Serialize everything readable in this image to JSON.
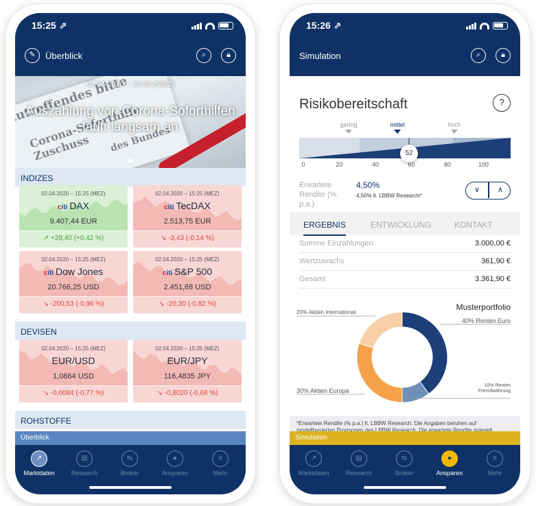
{
  "phone1": {
    "status": {
      "time": "15:25 ⇗"
    },
    "appbar": {
      "title": "Überblick"
    },
    "hero": {
      "meta": "02.04.2020 – 14:29 (MEZ)",
      "headline": "Auszahlung von Corona-Soforthilfen läuft langsam an",
      "paper_lines": [
        "Zutreffendes bitte",
        "Corona-Soforthilfe Zuschuss",
        "des Bundes"
      ]
    },
    "sections": [
      {
        "title": "INDIZES"
      },
      {
        "title": "DEVISEN"
      },
      {
        "title": "ROHSTOFFE"
      }
    ],
    "tiles": [
      {
        "date": "02.04.2020 – 15:25 (MEZ)",
        "brand": "citi",
        "name": "DAX",
        "value": "9.407,44 EUR",
        "change": "↗ +39,40 (+0,42 %)",
        "trend": "up"
      },
      {
        "date": "02.04.2020 – 15:25 (MEZ)",
        "brand": "citi",
        "name": "TecDAX",
        "value": "2.513,75 EUR",
        "change": "↘ -3,43 (-0,14 %)",
        "trend": "down"
      },
      {
        "date": "02.04.2020 – 15:25 (MEZ)",
        "brand": "citi",
        "name": "Dow Jones",
        "value": "20.766,25 USD",
        "change": "↘ -200,53 (-0,96 %)",
        "trend": "down"
      },
      {
        "date": "02.04.2020 – 15:25 (MEZ)",
        "brand": "citi",
        "name": "S&P 500",
        "value": "2.451,68 USD",
        "change": "↘ -20,30 (-0,82 %)",
        "trend": "down"
      },
      {
        "date": "02.04.2020 – 15:25 (MEZ)",
        "brand": "",
        "name": "EUR/USD",
        "value": "1,0864 USD",
        "change": "↘ -0,0084 (-0,77 %)",
        "trend": "down"
      },
      {
        "date": "02.04.2020 – 15:25 (MEZ)",
        "brand": "",
        "name": "EUR/JPY",
        "value": "116,4835 JPY",
        "change": "↘ -0,8020 (-0,68 %)",
        "trend": "down"
      }
    ],
    "mini_bar": "Überblick",
    "tabs": [
      {
        "label": "Marktdaten",
        "icon": "chart-icon"
      },
      {
        "label": "Research",
        "icon": "document-icon"
      },
      {
        "label": "Broker",
        "icon": "transfer-icon"
      },
      {
        "label": "Ansparen",
        "icon": "piggy-icon"
      },
      {
        "label": "Mehr",
        "icon": "more-icon"
      }
    ],
    "active_tab": 0,
    "colors": {
      "brand": "#0f3266",
      "up": "#4aa33a",
      "down": "#d9453d"
    }
  },
  "phone2": {
    "status": {
      "time": "15:26 ⇗"
    },
    "appbar": {
      "title": "Simulation"
    },
    "risk": {
      "title": "Risikobereitschaft",
      "help": "?",
      "levels": [
        "gering",
        "mittel",
        "hoch"
      ],
      "selected_level": "mittel",
      "scale_ticks": [
        "0",
        "20",
        "40",
        "60",
        "80",
        "100"
      ],
      "value": "52"
    },
    "return": {
      "label": "Erwartete Rendite (% p.a.)",
      "value": "4,50%",
      "sub": "4,50% lt. LBBW Research*"
    },
    "tabs2": [
      "ERGEBNIS",
      "ENTWICKLUNG",
      "KONTAKT"
    ],
    "results": [
      {
        "label": "Summe Einzahlungen",
        "value": "3.000,00 €"
      },
      {
        "label": "Wertzuwachs",
        "value": "361,90 €"
      },
      {
        "label": "Gesamt",
        "value": "3.361,90 €"
      }
    ],
    "portfolio_title": "Musterportfolio",
    "chart_data": {
      "type": "pie",
      "title": "Musterportfolio",
      "series": [
        {
          "name": "Renten Euro",
          "value": 40,
          "label": "40% Renten Euro",
          "color": "#1c3f78"
        },
        {
          "name": "Renten Fremdwährung",
          "value": 10,
          "label": "10% Renten Fremdwährung",
          "color": "#6f8fb8"
        },
        {
          "name": "Aktien Europa",
          "value": 30,
          "label": "30% Aktien Europa",
          "color": "#f5a14a"
        },
        {
          "name": "Aktien International",
          "value": 20,
          "label": "20% Aktien International",
          "color": "#f8cfa6"
        }
      ]
    },
    "disclaimer": "*Erwartete Rendite (% p.a.) lt. LBBW Research: Die Angaben beruhen auf modellbasierten Prognosen des LBBW Research. Die erwartete Rendite spiegelt Durchschnittswerte der jeweiligen Anlageklasse in",
    "mini_bar": "Simulation",
    "tabs": [
      {
        "label": "Marktdaten",
        "icon": "chart-icon"
      },
      {
        "label": "Research",
        "icon": "document-icon"
      },
      {
        "label": "Broker",
        "icon": "transfer-icon"
      },
      {
        "label": "Ansparen",
        "icon": "piggy-icon"
      },
      {
        "label": "Mehr",
        "icon": "more-icon"
      }
    ],
    "active_tab": 3,
    "colors": {
      "accent": "#f1b800"
    }
  }
}
